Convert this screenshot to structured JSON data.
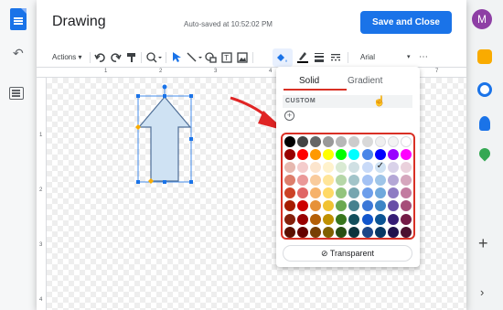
{
  "background": {
    "avatar_letter": "M",
    "undo_glyph": "↶",
    "plus_glyph": "+",
    "chevron_glyph": "›",
    "side_icons": [
      "keep-icon",
      "tasks-icon",
      "contacts-icon",
      "maps-icon"
    ],
    "side_icon_colors": [
      "#f9ab00",
      "#1a73e8",
      "#1a73e8",
      "#34a853"
    ]
  },
  "dialog": {
    "title": "Drawing",
    "autosave": "Auto-saved at 10:52:02 PM",
    "save_close": "Save and Close"
  },
  "toolbar": {
    "actions": "Actions ▾",
    "font": "Arial",
    "font_arrow": "▾",
    "more": "⋯",
    "icons": [
      "undo-icon",
      "redo-icon",
      "paint-format-icon",
      "zoom-icon",
      "select-icon",
      "line-icon",
      "shape-icon",
      "textbox-icon",
      "image-icon",
      "fill-color-icon",
      "border-color-icon",
      "border-weight-icon",
      "border-dash-icon"
    ]
  },
  "ruler": {
    "h_ticks": [
      "1",
      "2",
      "3",
      "4",
      "7"
    ],
    "v_ticks": [
      "1",
      "2",
      "3",
      "4"
    ]
  },
  "fill_popup": {
    "tab_solid": "Solid",
    "tab_gradient": "Gradient",
    "custom_label": "CUSTOM",
    "add_glyph": "+",
    "transparent_label": "Transparent",
    "swatches": [
      "#000000",
      "#434343",
      "#666666",
      "#999999",
      "#b7b7b7",
      "#cccccc",
      "#d9d9d9",
      "#efefef",
      "#f3f3f3",
      "#ffffff",
      "#980000",
      "#ff0000",
      "#ff9900",
      "#ffff00",
      "#00ff00",
      "#00ffff",
      "#4a86e8",
      "#0000ff",
      "#9900ff",
      "#ff00ff",
      "#e6b8af",
      "#f4cccc",
      "#fce5cd",
      "#fff2cc",
      "#d9ead3",
      "#d0e0e3",
      "#c9daf8",
      "#cfe2f3",
      "#d9d2e9",
      "#ead1dc",
      "#dd7e6b",
      "#ea9999",
      "#f9cb9c",
      "#ffe599",
      "#b6d7a8",
      "#a2c4c9",
      "#a4c2f4",
      "#9fc5e8",
      "#b4a7d6",
      "#d5a6bd",
      "#cc4125",
      "#e06666",
      "#f6b26b",
      "#ffd966",
      "#93c47d",
      "#76a5af",
      "#6d9eeb",
      "#6fa8dc",
      "#8e7cc3",
      "#c27ba0",
      "#a61c00",
      "#cc0000",
      "#e69138",
      "#f1c232",
      "#6aa84f",
      "#45818e",
      "#3c78d8",
      "#3d85c6",
      "#674ea7",
      "#a64d79",
      "#85200c",
      "#990000",
      "#b45f06",
      "#bf9000",
      "#38761d",
      "#134f5c",
      "#1155cc",
      "#0b5394",
      "#351c75",
      "#741b47",
      "#5b0f00",
      "#660000",
      "#783f04",
      "#7f6000",
      "#274e13",
      "#0c343d",
      "#1c4587",
      "#073763",
      "#20124d",
      "#4c1130"
    ],
    "selected_swatch": "#cfe2f3"
  },
  "shape": {
    "fill": "#cfe2f3",
    "stroke": "#4f6f97",
    "handle_color": "#1a73e8",
    "adjust_color": "#f9ab00"
  },
  "colors": {
    "accent": "#1a73e8",
    "highlight": "#d93025"
  }
}
